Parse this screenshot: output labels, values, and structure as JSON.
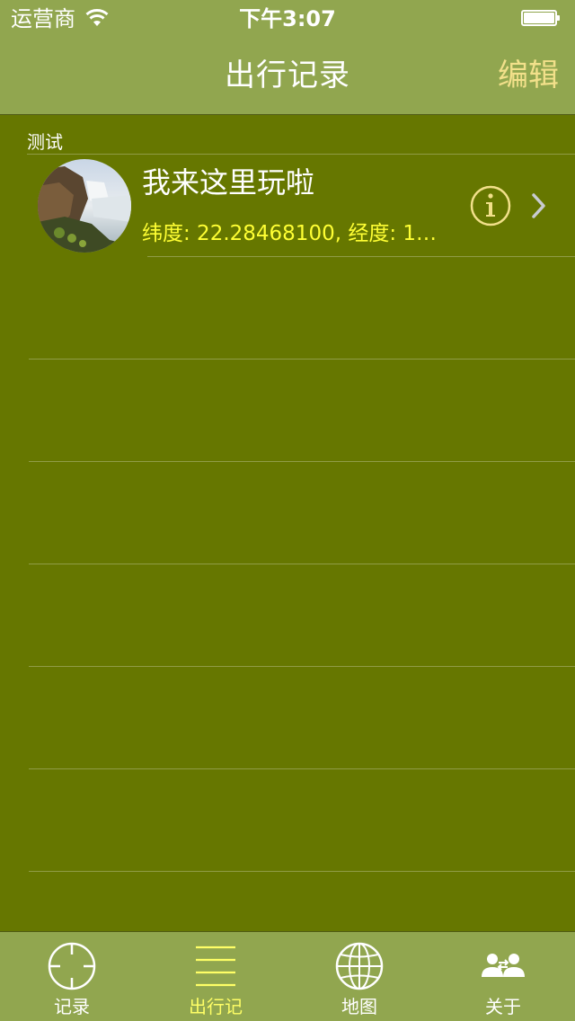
{
  "status_bar": {
    "carrier": "运营商",
    "time": "下午3:07"
  },
  "nav": {
    "title": "出行记录",
    "edit_label": "编辑"
  },
  "section": {
    "header": "测试"
  },
  "cells": [
    {
      "title": "我来这里玩啦",
      "subtitle": "纬度: 22.28468100, 经度: 11…",
      "thumbnail_icon": "waterfall-photo"
    }
  ],
  "tabs": [
    {
      "label": "记录",
      "icon": "crosshair-icon",
      "selected": false
    },
    {
      "label": "出行记",
      "icon": "list-lines-icon",
      "selected": true
    },
    {
      "label": "地图",
      "icon": "globe-icon",
      "selected": false
    },
    {
      "label": "关于",
      "icon": "people-icon",
      "selected": false
    }
  ],
  "colors": {
    "nav_background": "#91a64f",
    "table_background": "#667700",
    "edit_accent": "#f2e08a",
    "subtitle_yellow": "#ffff33",
    "selected_tab": "#ffff66"
  }
}
